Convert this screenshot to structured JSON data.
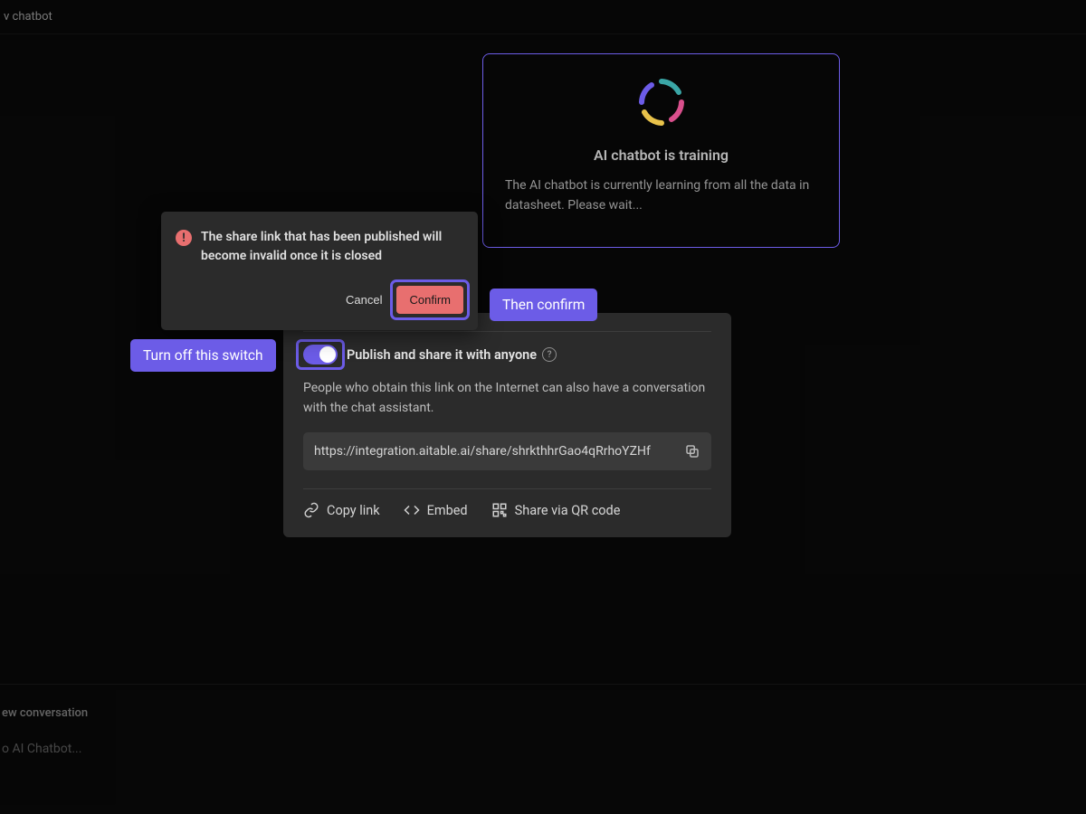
{
  "topbar": {
    "title": "v chatbot"
  },
  "training": {
    "title": "AI chatbot is training",
    "desc": "The AI chatbot is currently learning from all the data in datasheet. Please wait..."
  },
  "dialog": {
    "message": "The share link that has been published will become invalid once it is closed",
    "cancel": "Cancel",
    "confirm": "Confirm"
  },
  "share": {
    "toggle_label": "Publish and share it with anyone",
    "desc": "People who obtain this link on the Internet can also have a conversation with the chat assistant.",
    "url": "https://integration.aitable.ai/share/shrkthhrGao4qRrhoYZHf",
    "actions": {
      "copy": "Copy link",
      "embed": "Embed",
      "qr": "Share via QR code"
    }
  },
  "hints": {
    "switch": "Turn off this switch",
    "confirm": "Then confirm"
  },
  "bottom": {
    "new_conversation": "ew conversation",
    "input_placeholder": "o AI Chatbot..."
  }
}
